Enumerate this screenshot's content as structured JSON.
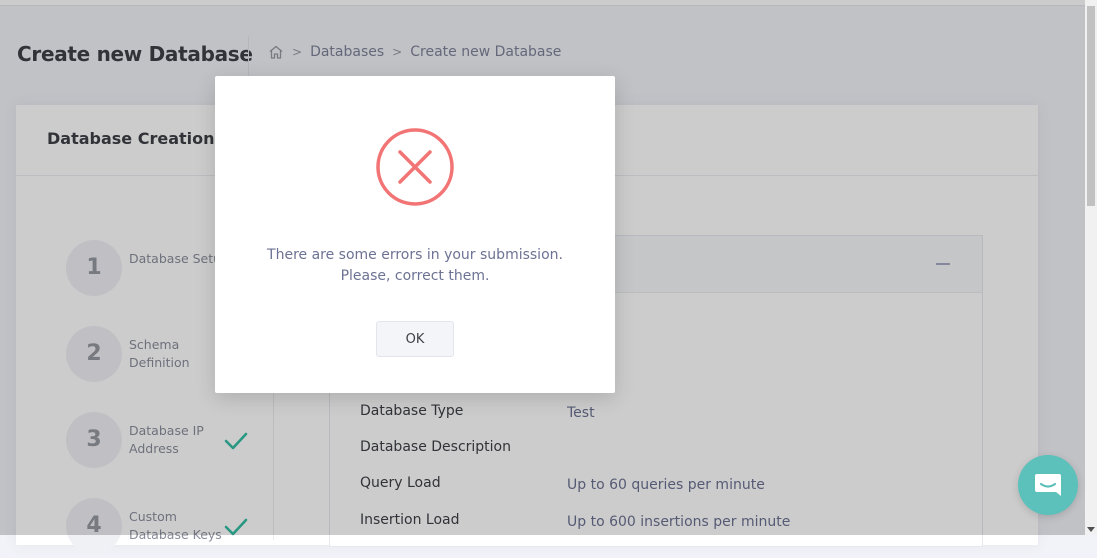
{
  "header": {
    "page_title": "Create new Database",
    "breadcrumb": [
      "Databases",
      "Create new Database"
    ],
    "breadcrumb_separator": ">"
  },
  "portlet": {
    "title": "Database Creation Wizard"
  },
  "wizard": {
    "steps": [
      {
        "number": "1",
        "label": "Database Setup",
        "completed": false
      },
      {
        "number": "2",
        "label": "Schema Definition",
        "completed": false
      },
      {
        "number": "3",
        "label": "Database IP Address",
        "completed": true
      },
      {
        "number": "4",
        "label": "Custom Database Keys",
        "completed": true
      }
    ]
  },
  "review": {
    "rows": [
      {
        "key": "Database Type",
        "value": "Test"
      },
      {
        "key": "Database Description",
        "value": ""
      },
      {
        "key": "Query Load",
        "value": "Up to 60 queries per minute"
      },
      {
        "key": "Insertion Load",
        "value": "Up to 600 insertions per minute"
      }
    ]
  },
  "modal": {
    "icon": "error-x-circle-icon",
    "message_line1": "There are some errors in your submission.",
    "message_line2": "Please, correct them.",
    "ok_label": "OK"
  },
  "colors": {
    "error": "#f27474",
    "check": "#34bfa3",
    "chat": "#5cc0bb"
  }
}
